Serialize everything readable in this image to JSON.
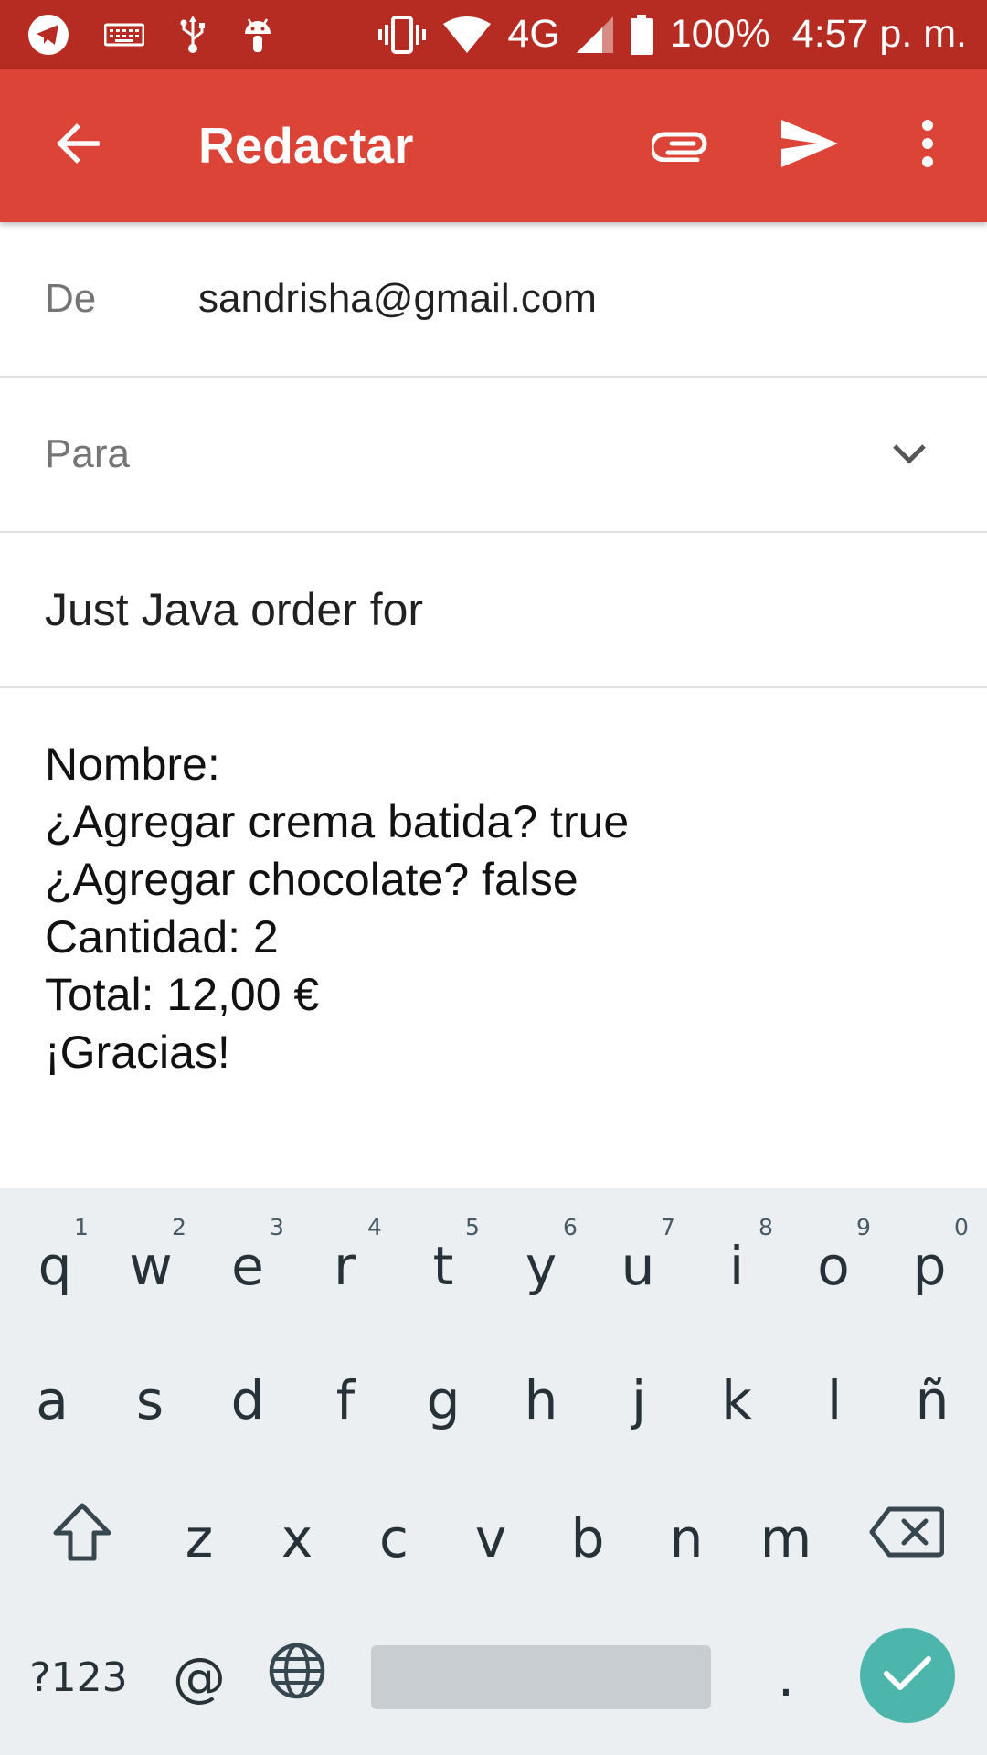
{
  "status_bar": {
    "battery": "100%",
    "network": "4G",
    "time": "4:57 p. m.",
    "icons": [
      "telegram-icon",
      "keyboard-icon",
      "usb-icon",
      "android-icon",
      "vibrate-icon",
      "wifi-icon",
      "signal-icon",
      "battery-icon"
    ],
    "background_color": "#b62c22"
  },
  "app_bar": {
    "title": "Redactar",
    "background_color": "#db4437",
    "icons": [
      "back-arrow-icon",
      "paperclip-icon",
      "send-icon",
      "more-vert-icon"
    ]
  },
  "compose": {
    "from_label": "De",
    "from_value": "sandrisha@gmail.com",
    "to_label": "Para",
    "to_value": "",
    "subject": "Just Java order for",
    "body_lines": [
      "Nombre:",
      "¿Agregar crema batida? true",
      "¿Agregar chocolate? false",
      "Cantidad: 2",
      "Total: 12,00 €",
      "¡Gracias!"
    ]
  },
  "keyboard": {
    "row1": [
      "q",
      "w",
      "e",
      "r",
      "t",
      "y",
      "u",
      "i",
      "o",
      "p"
    ],
    "row1_hints": [
      "1",
      "2",
      "3",
      "4",
      "5",
      "6",
      "7",
      "8",
      "9",
      "0"
    ],
    "row2": [
      "a",
      "s",
      "d",
      "f",
      "g",
      "h",
      "j",
      "k",
      "l",
      "ñ"
    ],
    "row3": [
      "z",
      "x",
      "c",
      "v",
      "b",
      "n",
      "m"
    ],
    "symbols_label": "?123",
    "at_label": "@",
    "period_label": ".",
    "enter_color": "#4db6ac",
    "icons": [
      "shift-icon",
      "backspace-icon",
      "globe-icon",
      "check-icon"
    ]
  }
}
